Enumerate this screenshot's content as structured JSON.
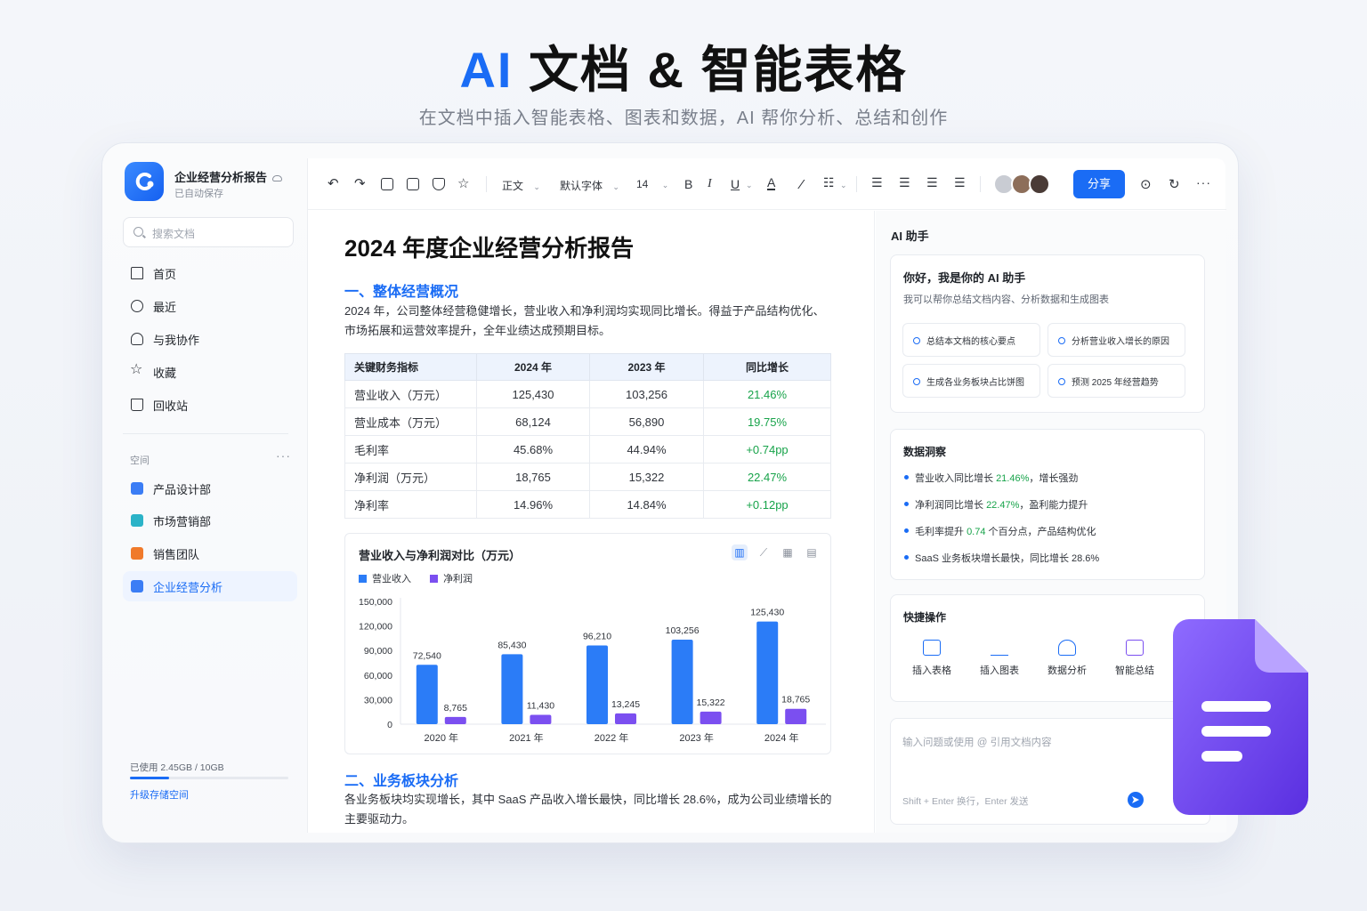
{
  "hero": {
    "title_accent": "AI",
    "title_rest": "文档 & 智能表格",
    "subtitle": "在文档中插入智能表格、图表和数据，AI 帮你分析、总结和创作"
  },
  "sidebar": {
    "doc_title": "企业经营分析报告",
    "autosave": "已自动保存",
    "search_placeholder": "搜索文档",
    "nav": [
      {
        "label": "首页",
        "icon": "home-icon"
      },
      {
        "label": "最近",
        "icon": "clock-icon"
      },
      {
        "label": "与我协作",
        "icon": "user-icon"
      },
      {
        "label": "收藏",
        "icon": "star-icon"
      },
      {
        "label": "回收站",
        "icon": "trash-icon"
      }
    ],
    "space_label": "空间",
    "space_more": "···",
    "spaces": [
      {
        "label": "产品设计部",
        "color": "#3b7df5"
      },
      {
        "label": "市场营销部",
        "color": "#2bb3c8"
      },
      {
        "label": "销售团队",
        "color": "#f07a2b"
      },
      {
        "label": "企业经营分析",
        "color": "#3b7df5"
      }
    ],
    "storage_text": "已使用 2.45GB / 10GB",
    "storage_ratio": 0.245,
    "upgrade": "升级存储空间"
  },
  "toolbar": {
    "style": "正文",
    "font": "默认字体",
    "size": "14",
    "bold": "B",
    "italic": "I",
    "underline": "U",
    "color": "A",
    "share": "分享"
  },
  "doc": {
    "title": "2024 年度企业经营分析报告",
    "section1": "一、整体经营概况",
    "para1": "2024 年，公司整体经营稳健增长，营业收入和净利润均实现同比增长。得益于产品结构优化、市场拓展和运营效率提升，全年业绩达成预期目标。",
    "table": {
      "headers": [
        "关键财务指标",
        "2024 年",
        "2023 年",
        "同比增长"
      ],
      "rows": [
        [
          "营业收入（万元）",
          "125,430",
          "103,256",
          "21.46%"
        ],
        [
          "营业成本（万元）",
          "68,124",
          "56,890",
          "19.75%"
        ],
        [
          "毛利率",
          "45.68%",
          "44.94%",
          "+0.74pp"
        ],
        [
          "净利润（万元）",
          "18,765",
          "15,322",
          "22.47%"
        ],
        [
          "净利率",
          "14.96%",
          "14.84%",
          "+0.12pp"
        ]
      ]
    },
    "section2": "二、业务板块分析",
    "para2": "各业务板块均实现增长，其中 SaaS 产品收入增长最快，同比增长 28.6%，成为公司业绩增长的主要驱动力。"
  },
  "chart_data": {
    "type": "bar",
    "title": "营业收入与净利润对比（万元）",
    "categories": [
      "2020 年",
      "2021 年",
      "2022 年",
      "2023 年",
      "2024 年"
    ],
    "series": [
      {
        "name": "营业收入",
        "values": [
          72540,
          85430,
          96210,
          103256,
          125430
        ],
        "color": "#2b7cf7"
      },
      {
        "name": "净利润",
        "values": [
          8765,
          11430,
          13245,
          15322,
          18765
        ],
        "color": "#7b4ff0"
      }
    ],
    "ylim": [
      0,
      150000
    ],
    "yticks": [
      "150,000",
      "120,000",
      "90,000",
      "60,000",
      "30,000",
      "0"
    ],
    "legend": "top-left",
    "grid": false
  },
  "ai": {
    "header": "AI 助手",
    "greeting": "你好，我是你的 AI 助手",
    "greeting_sub": "我可以帮你总结文档内容、分析数据和生成图表",
    "suggestions": [
      "总结本文档的核心要点",
      "分析营业收入增长的原因",
      "生成各业务板块占比饼图",
      "预测 2025 年经营趋势"
    ],
    "insights_title": "数据洞察",
    "insights": [
      {
        "pre": "营业收入同比增长 ",
        "hl": "21.46%",
        "post": "，增长强劲"
      },
      {
        "pre": "净利润同比增长 ",
        "hl": "22.47%",
        "post": "，盈利能力提升"
      },
      {
        "pre": "毛利率提升 ",
        "hl": "0.74",
        "post": " 个百分点，产品结构优化"
      },
      {
        "pre": "SaaS 业务板块增长最快，同比增长 28.6%",
        "hl": "",
        "post": ""
      }
    ],
    "quick_title": "快捷操作",
    "quick": [
      "插入表格",
      "插入图表",
      "数据分析",
      "智能总结"
    ],
    "input_placeholder": "输入问题或使用 @ 引用文档内容",
    "input_hint": "Shift + Enter 换行，Enter 发送"
  }
}
